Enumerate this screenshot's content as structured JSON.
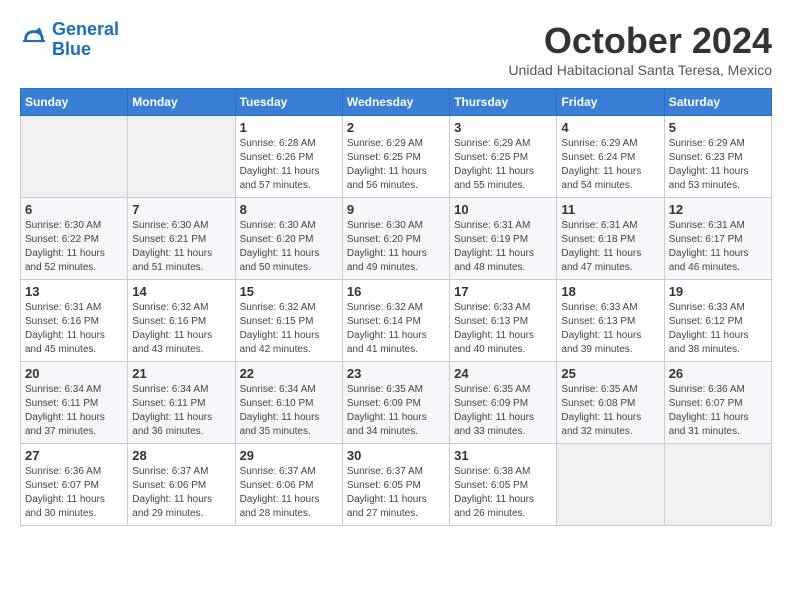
{
  "logo": {
    "line1": "General",
    "line2": "Blue"
  },
  "title": "October 2024",
  "subtitle": "Unidad Habitacional Santa Teresa, Mexico",
  "days_of_week": [
    "Sunday",
    "Monday",
    "Tuesday",
    "Wednesday",
    "Thursday",
    "Friday",
    "Saturday"
  ],
  "weeks": [
    [
      {
        "day": "",
        "info": ""
      },
      {
        "day": "",
        "info": ""
      },
      {
        "day": "1",
        "info": "Sunrise: 6:28 AM\nSunset: 6:26 PM\nDaylight: 11 hours\nand 57 minutes."
      },
      {
        "day": "2",
        "info": "Sunrise: 6:29 AM\nSunset: 6:25 PM\nDaylight: 11 hours\nand 56 minutes."
      },
      {
        "day": "3",
        "info": "Sunrise: 6:29 AM\nSunset: 6:25 PM\nDaylight: 11 hours\nand 55 minutes."
      },
      {
        "day": "4",
        "info": "Sunrise: 6:29 AM\nSunset: 6:24 PM\nDaylight: 11 hours\nand 54 minutes."
      },
      {
        "day": "5",
        "info": "Sunrise: 6:29 AM\nSunset: 6:23 PM\nDaylight: 11 hours\nand 53 minutes."
      }
    ],
    [
      {
        "day": "6",
        "info": "Sunrise: 6:30 AM\nSunset: 6:22 PM\nDaylight: 11 hours\nand 52 minutes."
      },
      {
        "day": "7",
        "info": "Sunrise: 6:30 AM\nSunset: 6:21 PM\nDaylight: 11 hours\nand 51 minutes."
      },
      {
        "day": "8",
        "info": "Sunrise: 6:30 AM\nSunset: 6:20 PM\nDaylight: 11 hours\nand 50 minutes."
      },
      {
        "day": "9",
        "info": "Sunrise: 6:30 AM\nSunset: 6:20 PM\nDaylight: 11 hours\nand 49 minutes."
      },
      {
        "day": "10",
        "info": "Sunrise: 6:31 AM\nSunset: 6:19 PM\nDaylight: 11 hours\nand 48 minutes."
      },
      {
        "day": "11",
        "info": "Sunrise: 6:31 AM\nSunset: 6:18 PM\nDaylight: 11 hours\nand 47 minutes."
      },
      {
        "day": "12",
        "info": "Sunrise: 6:31 AM\nSunset: 6:17 PM\nDaylight: 11 hours\nand 46 minutes."
      }
    ],
    [
      {
        "day": "13",
        "info": "Sunrise: 6:31 AM\nSunset: 6:16 PM\nDaylight: 11 hours\nand 45 minutes."
      },
      {
        "day": "14",
        "info": "Sunrise: 6:32 AM\nSunset: 6:16 PM\nDaylight: 11 hours\nand 43 minutes."
      },
      {
        "day": "15",
        "info": "Sunrise: 6:32 AM\nSunset: 6:15 PM\nDaylight: 11 hours\nand 42 minutes."
      },
      {
        "day": "16",
        "info": "Sunrise: 6:32 AM\nSunset: 6:14 PM\nDaylight: 11 hours\nand 41 minutes."
      },
      {
        "day": "17",
        "info": "Sunrise: 6:33 AM\nSunset: 6:13 PM\nDaylight: 11 hours\nand 40 minutes."
      },
      {
        "day": "18",
        "info": "Sunrise: 6:33 AM\nSunset: 6:13 PM\nDaylight: 11 hours\nand 39 minutes."
      },
      {
        "day": "19",
        "info": "Sunrise: 6:33 AM\nSunset: 6:12 PM\nDaylight: 11 hours\nand 38 minutes."
      }
    ],
    [
      {
        "day": "20",
        "info": "Sunrise: 6:34 AM\nSunset: 6:11 PM\nDaylight: 11 hours\nand 37 minutes."
      },
      {
        "day": "21",
        "info": "Sunrise: 6:34 AM\nSunset: 6:11 PM\nDaylight: 11 hours\nand 36 minutes."
      },
      {
        "day": "22",
        "info": "Sunrise: 6:34 AM\nSunset: 6:10 PM\nDaylight: 11 hours\nand 35 minutes."
      },
      {
        "day": "23",
        "info": "Sunrise: 6:35 AM\nSunset: 6:09 PM\nDaylight: 11 hours\nand 34 minutes."
      },
      {
        "day": "24",
        "info": "Sunrise: 6:35 AM\nSunset: 6:09 PM\nDaylight: 11 hours\nand 33 minutes."
      },
      {
        "day": "25",
        "info": "Sunrise: 6:35 AM\nSunset: 6:08 PM\nDaylight: 11 hours\nand 32 minutes."
      },
      {
        "day": "26",
        "info": "Sunrise: 6:36 AM\nSunset: 6:07 PM\nDaylight: 11 hours\nand 31 minutes."
      }
    ],
    [
      {
        "day": "27",
        "info": "Sunrise: 6:36 AM\nSunset: 6:07 PM\nDaylight: 11 hours\nand 30 minutes."
      },
      {
        "day": "28",
        "info": "Sunrise: 6:37 AM\nSunset: 6:06 PM\nDaylight: 11 hours\nand 29 minutes."
      },
      {
        "day": "29",
        "info": "Sunrise: 6:37 AM\nSunset: 6:06 PM\nDaylight: 11 hours\nand 28 minutes."
      },
      {
        "day": "30",
        "info": "Sunrise: 6:37 AM\nSunset: 6:05 PM\nDaylight: 11 hours\nand 27 minutes."
      },
      {
        "day": "31",
        "info": "Sunrise: 6:38 AM\nSunset: 6:05 PM\nDaylight: 11 hours\nand 26 minutes."
      },
      {
        "day": "",
        "info": ""
      },
      {
        "day": "",
        "info": ""
      }
    ]
  ]
}
